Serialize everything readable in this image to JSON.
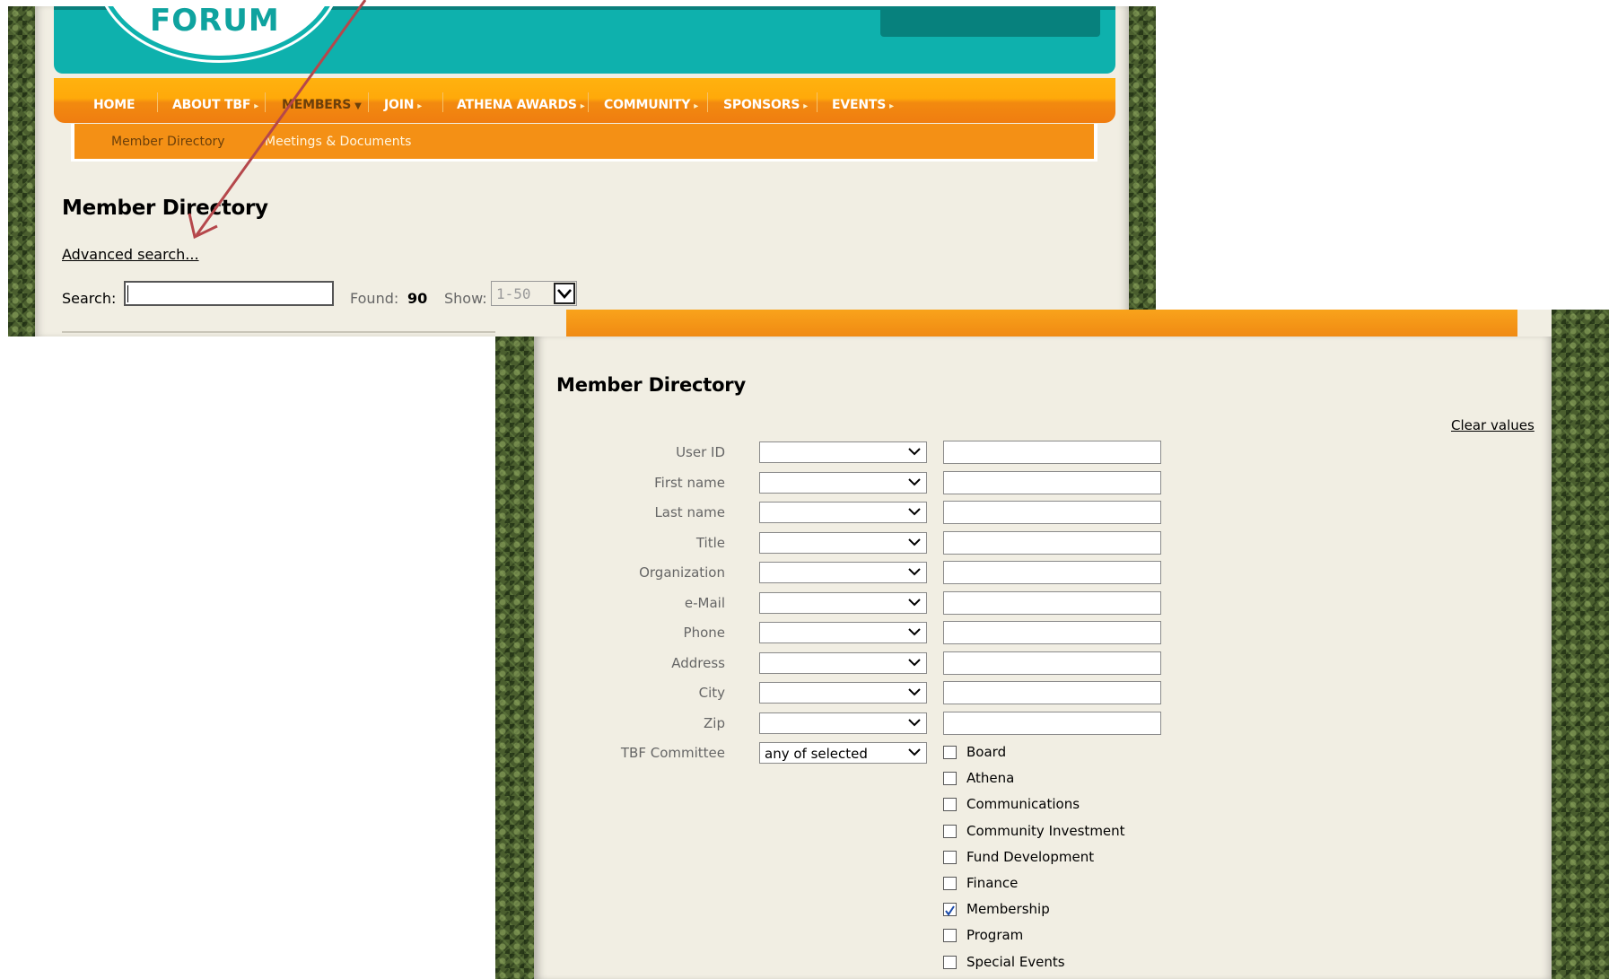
{
  "logo": {
    "text": "FORUM"
  },
  "nav": {
    "items": [
      {
        "label": "HOME"
      },
      {
        "label": "ABOUT TBF"
      },
      {
        "label": "MEMBERS"
      },
      {
        "label": "JOIN"
      },
      {
        "label": "ATHENA AWARDS"
      },
      {
        "label": "COMMUNITY"
      },
      {
        "label": "SPONSORS"
      },
      {
        "label": "EVENTS"
      }
    ],
    "sub_items": [
      {
        "label": "Member Directory"
      },
      {
        "label": "Meetings & Documents"
      }
    ]
  },
  "directory": {
    "title": "Member Directory",
    "advanced_link": "Advanced search...",
    "search_label": "Search:",
    "search_value": "",
    "found_label": "Found:",
    "found_value": "90",
    "show_label": "Show:",
    "show_value": "1-50"
  },
  "advanced": {
    "title": "Member Directory",
    "clear_link": "Clear values",
    "fields": [
      {
        "label": "User ID"
      },
      {
        "label": "First name"
      },
      {
        "label": "Last name"
      },
      {
        "label": "Title"
      },
      {
        "label": "Organization"
      },
      {
        "label": "e-Mail"
      },
      {
        "label": "Phone"
      },
      {
        "label": "Address"
      },
      {
        "label": "City"
      },
      {
        "label": "Zip"
      }
    ],
    "committee": {
      "label": "TBF Committee",
      "mode": "any of selected",
      "options": [
        {
          "label": "Board",
          "checked": false
        },
        {
          "label": "Athena",
          "checked": false
        },
        {
          "label": "Communications",
          "checked": false
        },
        {
          "label": "Community Investment",
          "checked": false
        },
        {
          "label": "Fund Development",
          "checked": false
        },
        {
          "label": "Finance",
          "checked": false
        },
        {
          "label": "Membership",
          "checked": true
        },
        {
          "label": "Program",
          "checked": false
        },
        {
          "label": "Special Events",
          "checked": false
        }
      ]
    }
  },
  "colors": {
    "teal": "#0eb1ad",
    "orange": "#f49015",
    "arrow": "#b5474b"
  }
}
